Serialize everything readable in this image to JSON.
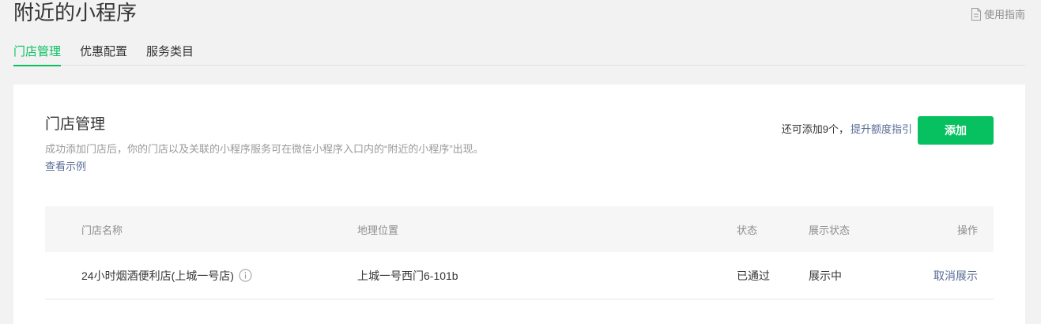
{
  "page": {
    "title": "附近的小程序",
    "guide_label": "使用指南"
  },
  "tabs": [
    {
      "label": "门店管理",
      "active": true
    },
    {
      "label": "优惠配置",
      "active": false
    },
    {
      "label": "服务类目",
      "active": false
    }
  ],
  "section": {
    "title": "门店管理",
    "description": "成功添加门店后，你的门店以及关联的小程序服务可在微信小程序入口内的“附近的小程序”出现。",
    "example_link": "查看示例",
    "quota_text": "还可添加9个，",
    "upgrade_link": "提升额度指引",
    "add_button": "添加"
  },
  "table": {
    "headers": {
      "name": "门店名称",
      "location": "地理位置",
      "status": "状态",
      "display_status": "展示状态",
      "action": "操作"
    },
    "rows": [
      {
        "name": "24小时烟酒便利店(上城一号店)",
        "location": "上城一号西门6-101b",
        "status": "已通过",
        "display_status": "展示中",
        "action": "取消展示"
      }
    ]
  },
  "colors": {
    "accent": "#07c160",
    "link": "#576b95",
    "background": "#f2f2f2"
  },
  "icons": {
    "guide": "document-icon",
    "row_info": "info-icon"
  }
}
